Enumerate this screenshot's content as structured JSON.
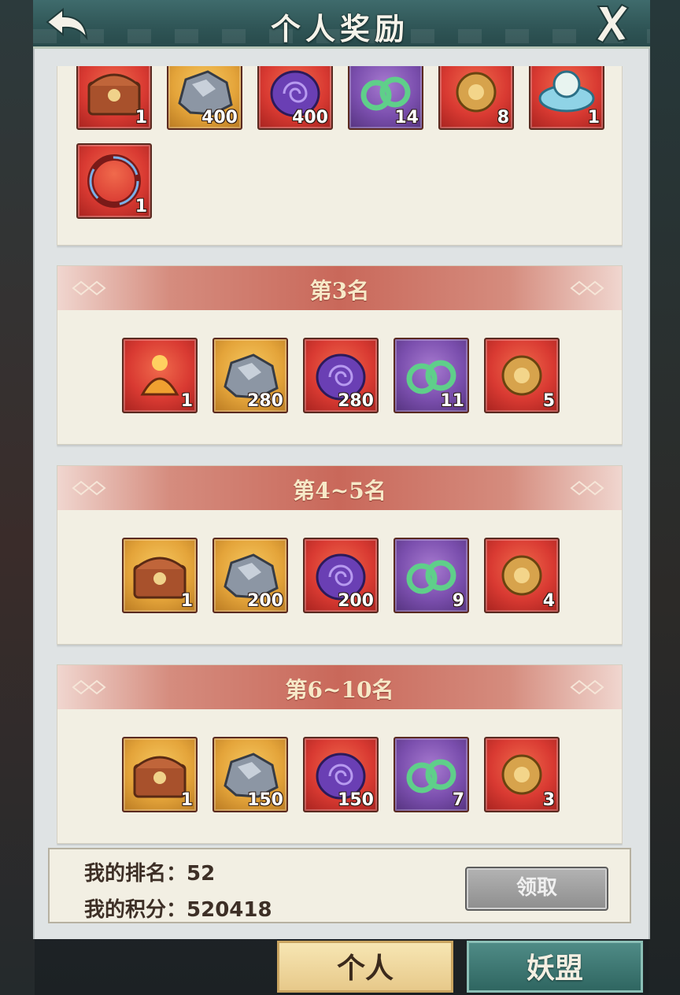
{
  "header": {
    "title": "个人奖励"
  },
  "sections": [
    {
      "label": "",
      "items": [
        {
          "icon": "treasure-chest-icon",
          "count": "1"
        },
        {
          "icon": "ore-stone-icon",
          "count": "400"
        },
        {
          "icon": "spirit-egg-icon",
          "count": "400"
        },
        {
          "icon": "jade-dragon-icon",
          "count": "14"
        },
        {
          "icon": "golden-flower-icon",
          "count": "8"
        },
        {
          "icon": "cloud-badge-icon",
          "count": "1"
        },
        {
          "icon": "flame-ring-frame-icon",
          "count": "1"
        }
      ]
    },
    {
      "label": "第3名",
      "items": [
        {
          "icon": "fire-pouch-icon",
          "count": "1"
        },
        {
          "icon": "ore-stone-icon",
          "count": "280"
        },
        {
          "icon": "spirit-egg-icon",
          "count": "280"
        },
        {
          "icon": "jade-dragon-icon",
          "count": "11"
        },
        {
          "icon": "golden-flower-icon",
          "count": "5"
        }
      ]
    },
    {
      "label": "第4~5名",
      "items": [
        {
          "icon": "treasure-chest-icon",
          "count": "1"
        },
        {
          "icon": "ore-stone-icon",
          "count": "200"
        },
        {
          "icon": "spirit-egg-icon",
          "count": "200"
        },
        {
          "icon": "jade-dragon-icon",
          "count": "9"
        },
        {
          "icon": "golden-flower-icon",
          "count": "4"
        }
      ]
    },
    {
      "label": "第6~10名",
      "items": [
        {
          "icon": "treasure-chest-icon",
          "count": "1"
        },
        {
          "icon": "ore-stone-icon",
          "count": "150"
        },
        {
          "icon": "spirit-egg-icon",
          "count": "150"
        },
        {
          "icon": "jade-dragon-icon",
          "count": "7"
        },
        {
          "icon": "golden-flower-icon",
          "count": "3"
        }
      ]
    }
  ],
  "info": {
    "rank_label": "我的排名：",
    "rank_value": "52",
    "score_label": "我的积分：",
    "score_value": "520418",
    "claim_button": "领取"
  },
  "tabs": {
    "personal": "个人",
    "alliance": "妖盟"
  },
  "colors": {
    "accent_red": "#c9685a",
    "panel_bg": "#f2efe3",
    "header_teal": "#2f5556"
  }
}
